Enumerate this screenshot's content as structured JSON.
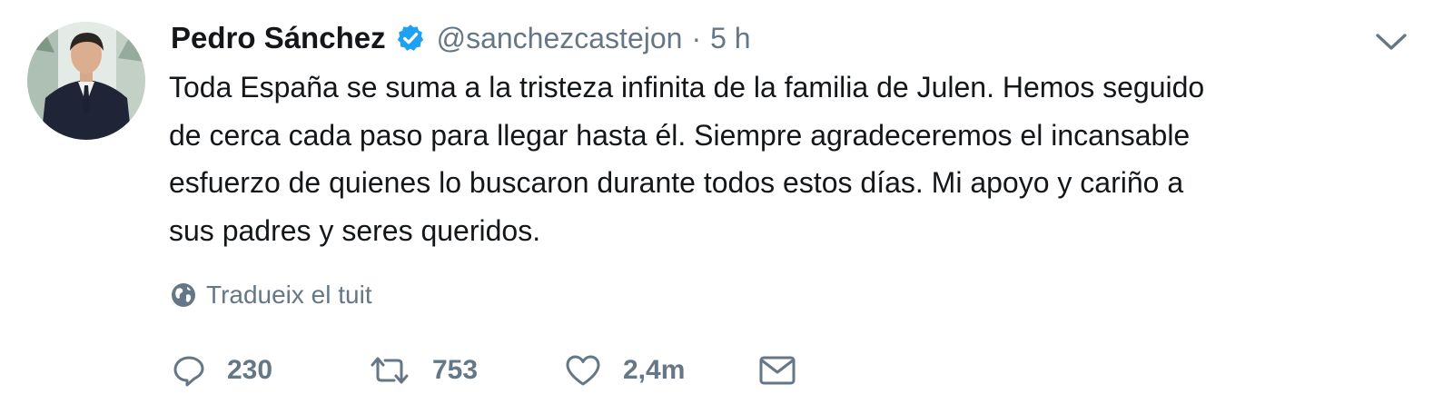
{
  "tweet": {
    "author_name": "Pedro Sánchez",
    "handle": "@sanchezcastejon",
    "separator": "·",
    "time": "5 h",
    "text": "Toda España se suma a la tristeza  infinita de la familia de Julen. Hemos seguido\nde cerca cada paso para llegar hasta él. Siempre agradeceremos el incansable\nesfuerzo de quienes lo buscaron durante todos estos días. Mi apoyo y cariño a\nsus padres y seres queridos.",
    "translate_label": "Tradueix el tuit"
  },
  "actions": {
    "reply_count": "230",
    "retweet_count": "753",
    "like_count": "2,4m"
  },
  "icons": {
    "verified": "verified-badge-icon",
    "caret": "chevron-down-icon",
    "globe": "globe-icon",
    "reply": "reply-icon",
    "retweet": "retweet-icon",
    "like": "heart-icon",
    "dm": "envelope-icon"
  },
  "colors": {
    "text": "#14171a",
    "secondary": "#657786",
    "verified": "#1da1f2"
  }
}
